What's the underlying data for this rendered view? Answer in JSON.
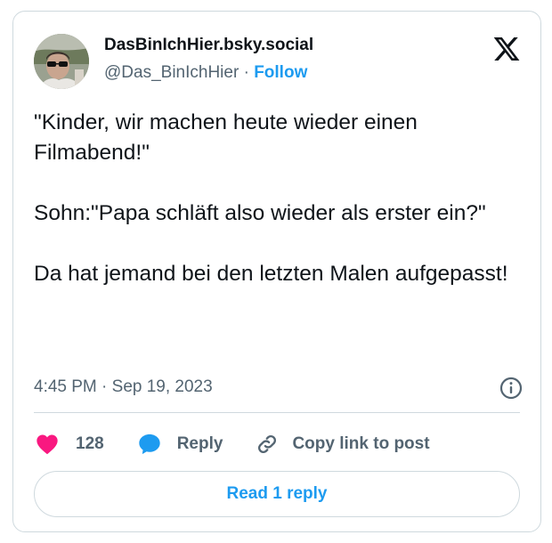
{
  "author": {
    "display_name": "DasBinIchHier.bsky.social",
    "handle": "@Das_BinIchHier",
    "separator": " · ",
    "follow_label": "Follow"
  },
  "tweet": {
    "text": "\"Kinder, wir machen heute wieder einen Filmabend!\"\n\nSohn:\"Papa schläft also wieder als erster ein?\"\n\nDa hat jemand bei den letzten Malen aufgepasst!",
    "timestamp": "4:45 PM · Sep 19, 2023"
  },
  "actions": {
    "like_count": "128",
    "reply_label": "Reply",
    "copy_link_label": "Copy link to post"
  },
  "read_replies_label": "Read 1 reply",
  "icons": {
    "brand": "x-logo-icon",
    "like": "heart-icon",
    "reply": "speech-bubble-icon",
    "copy": "link-icon",
    "info": "info-icon"
  },
  "colors": {
    "text": "#0f1419",
    "secondary_text": "#536471",
    "accent": "#1d9bf0",
    "like": "#f91880",
    "border": "#cfd9de"
  }
}
